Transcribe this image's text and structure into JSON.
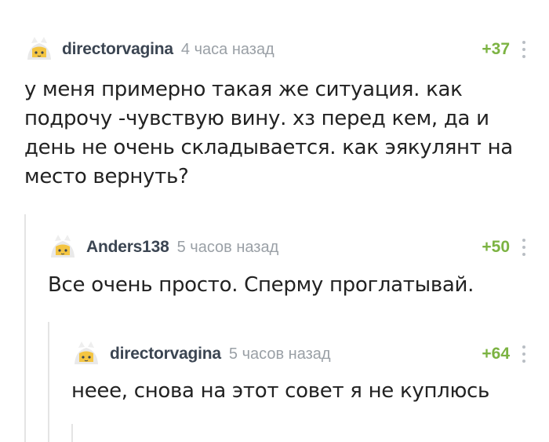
{
  "comments": [
    {
      "username": "directorvagina",
      "time": "4 часа назад",
      "rating": "+37",
      "text_lines": [
        "у меня примерно такая же ситуация. как",
        "подрочу -чувствую вину. хз перед кем, да и",
        "день не очень складывается. как эякулянт на",
        "место вернуть?"
      ]
    },
    {
      "username": "Anders138",
      "time": "5 часов назад",
      "rating": "+50",
      "text_lines": [
        "Все очень просто. Сперму проглатывай."
      ]
    },
    {
      "username": "directorvagina",
      "time": "5 часов назад",
      "rating": "+64",
      "text_lines": [
        "неее, снова на этот совет я не куплюсь"
      ]
    }
  ],
  "colors": {
    "username": "#3b4552",
    "time": "#9aa0a6",
    "rating_positive": "#7cb342",
    "thread_line": "#e4e4e4",
    "avatar_ears": "#f4c542"
  },
  "icons": {
    "avatar": "default-avatar-icon",
    "more": "more-vertical-icon"
  }
}
